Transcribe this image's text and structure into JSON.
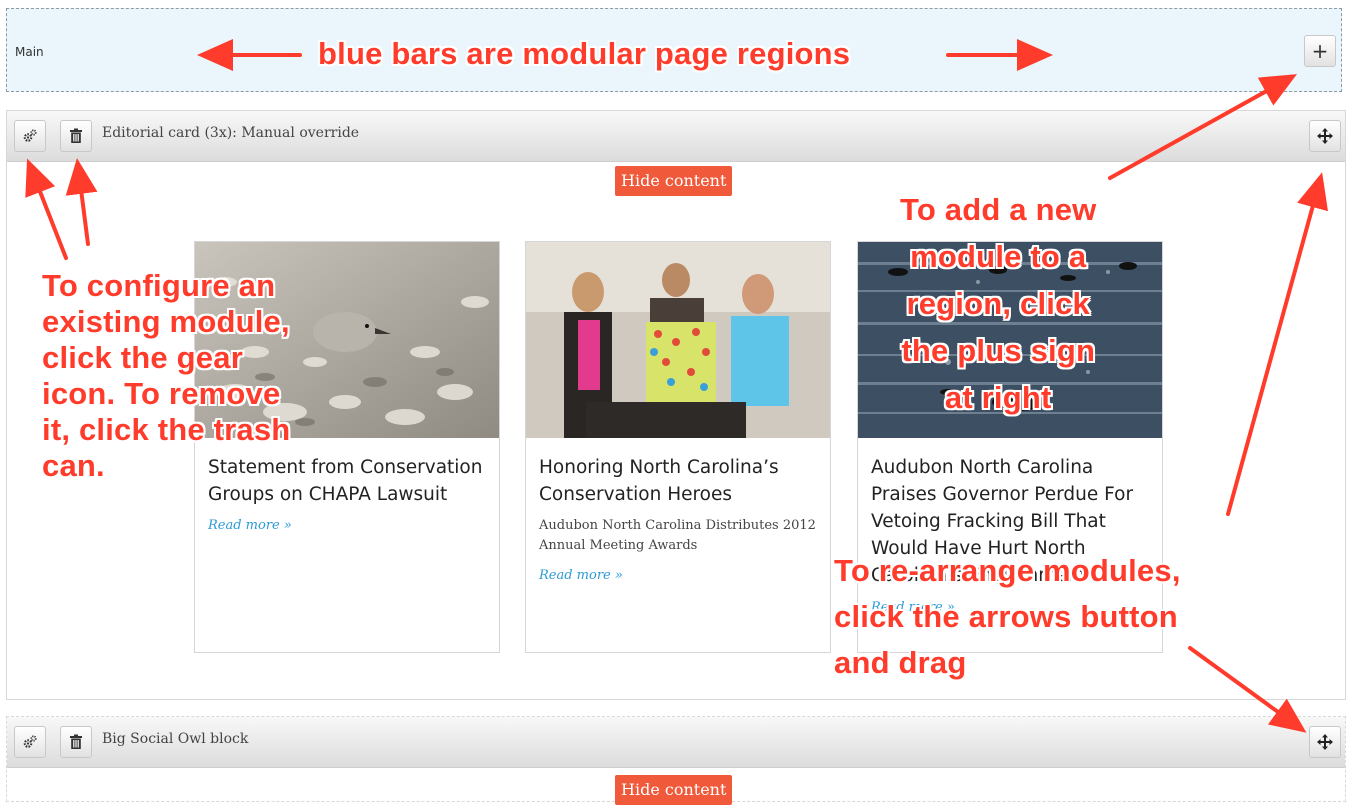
{
  "region": {
    "label": "Main",
    "add_icon": "plus-icon"
  },
  "modules": [
    {
      "title": "Editorial card (3x): Manual override",
      "hide_label": "Hide content",
      "icons": {
        "configure": "gear-icon",
        "remove": "trash-icon",
        "move": "move-arrows-icon"
      }
    },
    {
      "title": "Big Social Owl block",
      "hide_label": "Hide content",
      "icons": {
        "configure": "gear-icon",
        "remove": "trash-icon",
        "move": "move-arrows-icon"
      }
    }
  ],
  "cards": [
    {
      "title": "Statement from Conservation Groups on CHAPA Lawsuit",
      "subtitle": "",
      "link": "Read more »"
    },
    {
      "title": "Honoring North Carolina’s Conservation Heroes",
      "subtitle": "Audubon North Carolina Distributes 2012 Annual Meeting Awards",
      "link": "Read more »"
    },
    {
      "title": "Audubon North Carolina Praises Governor Perdue For Vetoing Fracking Bill That Would Have Hurt North Carolina’s Environment",
      "subtitle": "",
      "link": "Read more »"
    }
  ],
  "annotations": {
    "regions": "blue bars are modular page regions",
    "configure": [
      "To configure an",
      "existing module,",
      "click the gear",
      "icon. To remove",
      "it, click the trash",
      "can."
    ],
    "add": [
      "To add a new",
      "module to a",
      "region, click",
      "the plus sign",
      "at right"
    ],
    "rearrange": [
      "To re-arrange modules,",
      "click the arrows button",
      "and drag"
    ]
  },
  "colors": {
    "annotation": "#ff3b2b",
    "hide_button": "#f05a3a",
    "region_bg": "#eaf6fc",
    "link": "#2b9bd6"
  }
}
